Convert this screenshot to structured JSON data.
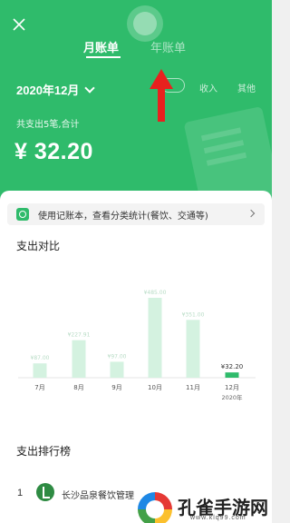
{
  "header": {
    "tabs": [
      {
        "label": "月账单",
        "active": true
      },
      {
        "label": "年账单",
        "active": false
      }
    ],
    "month_select": "2020年12月",
    "segments": [
      "支出",
      "收入",
      "其他"
    ],
    "summary_label": "共支出5笔,合计",
    "total_amount": "¥ 32.20",
    "accent_color": "#2fbb6b",
    "arrow_color": "#e8211e"
  },
  "tip": {
    "text": "使用记账本，查看分类统计(餐饮、交通等)"
  },
  "sections": {
    "compare_title": "支出对比",
    "rank_title": "支出排行榜"
  },
  "chart_data": {
    "type": "bar",
    "categories": [
      "7月",
      "8月",
      "9月",
      "10月",
      "11月",
      "12月"
    ],
    "values": [
      87.0,
      227.91,
      97.0,
      485.0,
      351.0,
      32.2
    ],
    "value_labels": [
      "¥87.00",
      "¥227.91",
      "¥97.00",
      "¥485.00",
      "¥351.00",
      "¥32.20"
    ],
    "highlight_index": 5,
    "year_note": "2020年",
    "bar_color": "#d4f2e0",
    "highlight_color": "#2fbb6b"
  },
  "ranking": [
    {
      "rank": "1",
      "name": "长沙品泉餐饮管理"
    }
  ],
  "watermark": {
    "title": "孔雀手游网",
    "url": "www.klq99.com"
  }
}
